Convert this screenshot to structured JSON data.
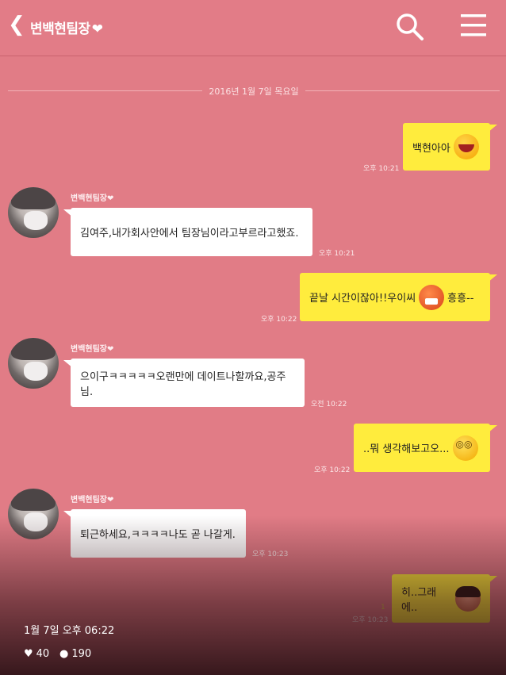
{
  "header": {
    "title": "변백현팀장",
    "title_heart": "❤",
    "back_icon": "chevron-left-icon",
    "search_icon": "search-icon",
    "menu_icon": "hamburger-menu-icon"
  },
  "date_divider": "2016년 1월 7일 목요일",
  "sender_name": "변백현팀장❤",
  "messages": [
    {
      "side": "right",
      "text": "백현아아",
      "emoji": "grinning-face-emoji",
      "time": "오후 10:21"
    },
    {
      "side": "left",
      "text": "김여주,내가회사안에서 팀장님이라고부르라고했죠.",
      "time": "오후 10:21"
    },
    {
      "side": "right",
      "text": "끝날 시간이잖아!!우이씨",
      "emoji": "devil-face-emoji",
      "text_after": "흥흥--",
      "time": "오후 10:22"
    },
    {
      "side": "left",
      "text": "으이구ㅋㅋㅋㅋㅋ오랜만에 데이트나할까요,공주님.",
      "time": "오전 10:22"
    },
    {
      "side": "right",
      "text": "..뭐 생각해보고오...",
      "emoji": "dizzy-face-emoji",
      "time": "오후 10:22"
    },
    {
      "side": "left",
      "text": "퇴근하세요,ㅋㅋㅋㅋ나도 곧 나갈게.",
      "time": "오후 10:23"
    },
    {
      "side": "right",
      "text": "히..그래에..",
      "emoji": "shy-face-emoji",
      "time": "오후 10:23",
      "unread": "1"
    }
  ],
  "post": {
    "date": "1월 7일 오후 06:22",
    "likes": "40",
    "comments": "190",
    "like_icon": "heart-icon",
    "comment_icon": "comment-bubble-icon"
  },
  "colors": {
    "background": "#e17c86",
    "my_bubble": "#ffec3d",
    "their_bubble": "#ffffff"
  }
}
